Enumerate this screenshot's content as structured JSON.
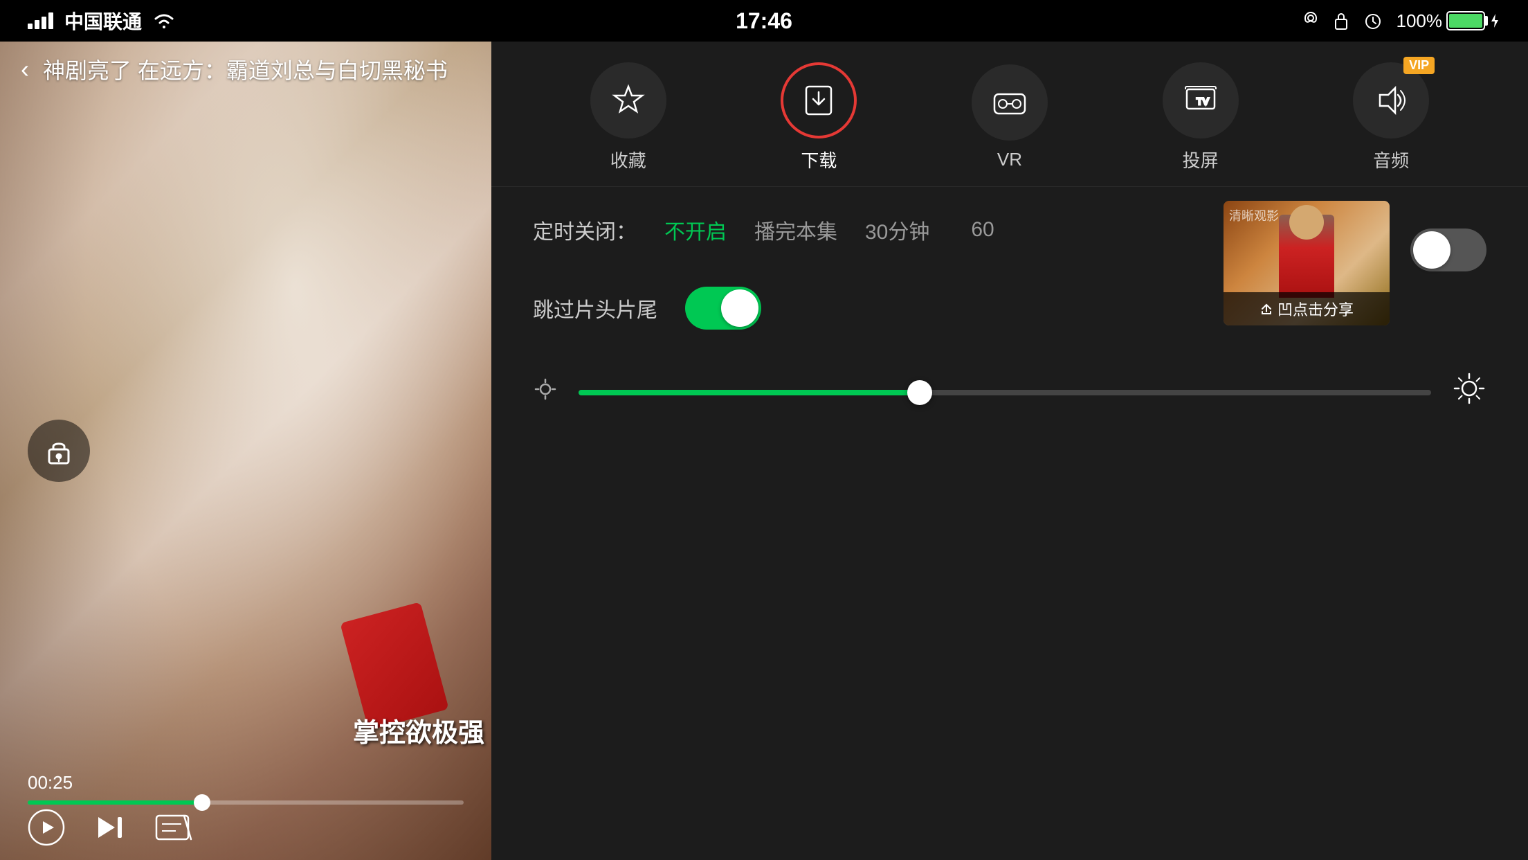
{
  "statusBar": {
    "carrier": "中国联通",
    "time": "17:46",
    "battery": "100%",
    "batteryCharging": true
  },
  "videoPanel": {
    "backLabel": "‹",
    "title": "神剧亮了 在远方：霸道刘总与白切黑秘书",
    "currentTime": "00:25",
    "subtitle": "掌控欲极强",
    "progressPercent": 40
  },
  "rightPanel": {
    "icons": [
      {
        "id": "collect",
        "label": "收藏",
        "highlighted": false
      },
      {
        "id": "download",
        "label": "下载",
        "highlighted": true
      },
      {
        "id": "vr",
        "label": "VR",
        "highlighted": false
      },
      {
        "id": "cast",
        "label": "投屏",
        "highlighted": false
      },
      {
        "id": "audio",
        "label": "音频",
        "highlighted": false,
        "vip": true
      }
    ],
    "timer": {
      "label": "定时关闭：",
      "options": [
        "不开启",
        "播完本集",
        "30分钟",
        "60"
      ]
    },
    "skipIntro": {
      "label": "跳过片头片尾",
      "enabled": true
    },
    "thumbnail": {
      "watermark": "清晰观影",
      "shareText": "凹点击分享"
    },
    "brightness": {
      "value": 40
    }
  }
}
